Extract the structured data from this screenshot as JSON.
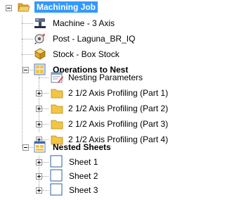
{
  "tree": {
    "root": {
      "label": "Machining Job",
      "icon": "folder-open-icon",
      "selected": true
    },
    "machine": {
      "label": "Machine - 3 Axis",
      "icon": "machine-icon"
    },
    "post": {
      "label": "Post - Laguna_BR_IQ",
      "icon": "post-icon"
    },
    "stock": {
      "label": "Stock - Box Stock",
      "icon": "stock-box-icon"
    },
    "operations": {
      "label": "Operations to Nest",
      "icon": "nest-operations-icon",
      "params": {
        "label": "Nesting Parameters",
        "icon": "parameters-icon"
      },
      "items": [
        {
          "label": "2 1/2 Axis Profiling (Part 1)",
          "icon": "folder-icon"
        },
        {
          "label": "2 1/2 Axis Profiling (Part 2)",
          "icon": "folder-icon"
        },
        {
          "label": "2 1/2 Axis Profiling (Part 3)",
          "icon": "folder-icon"
        },
        {
          "label": "2 1/2 Axis Profiling (Part 4)",
          "icon": "folder-icon"
        }
      ]
    },
    "sheets": {
      "label": "Nested Sheets",
      "icon": "nested-sheets-icon",
      "items": [
        {
          "label": "Sheet 1",
          "icon": "sheet-icon"
        },
        {
          "label": "Sheet 2",
          "icon": "sheet-icon"
        },
        {
          "label": "Sheet 3",
          "icon": "sheet-icon"
        }
      ]
    }
  },
  "colors": {
    "selection": "#3399ff",
    "folder": "#f3c445",
    "tree_lines": "#a0a0a0"
  }
}
